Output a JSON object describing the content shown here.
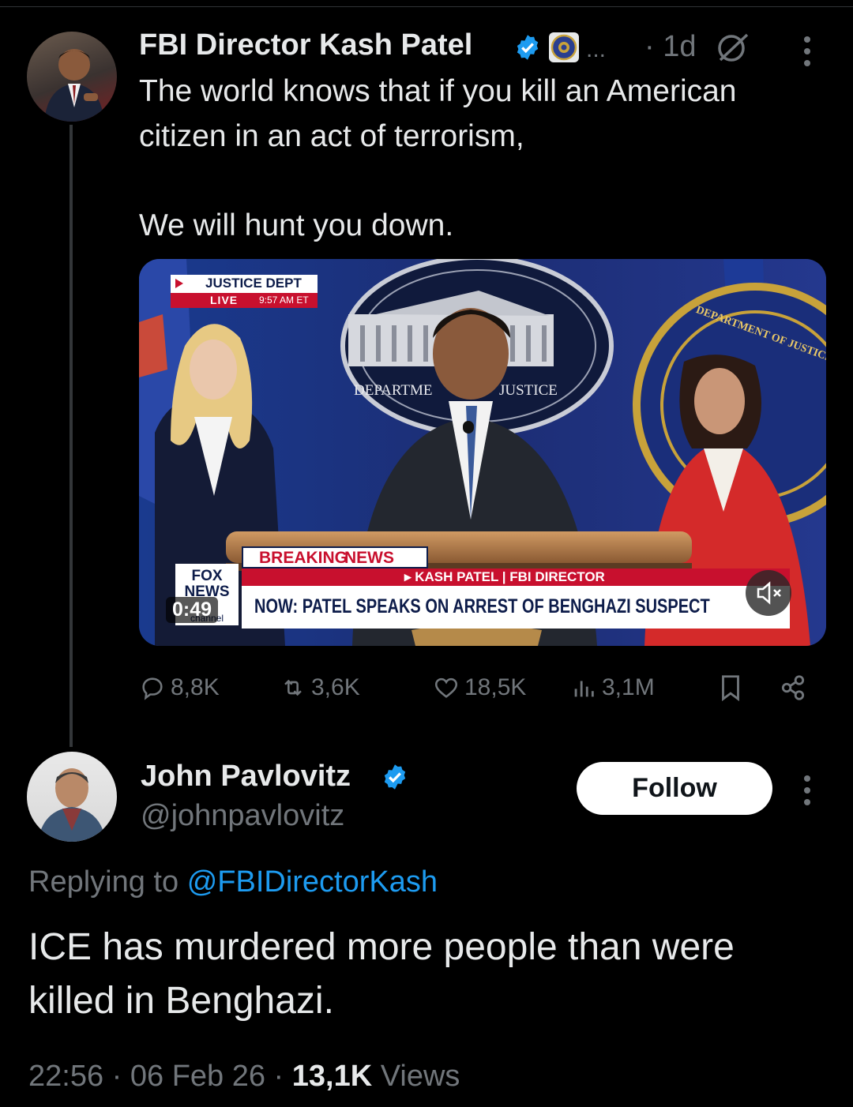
{
  "original_tweet": {
    "author_name": "FBI Director Kash Patel",
    "more_ellipsis": "...",
    "time": "· 1d",
    "text_line1": "The world knows that if you kill an American",
    "text_line2": "citizen in an act of terrorism,",
    "text_line3": "We will hunt you down.",
    "video": {
      "justice_dept_label": "JUSTICE DEPT",
      "live_label": "LIVE",
      "live_time": "9:57 AM ET",
      "seal_text_left": "DEPARTME",
      "seal_text_right": "JUSTICE",
      "fbi_seal_text": "DEPARTMENT OF JUSTICE",
      "breaking": "BREAKING",
      "news": "NEWS",
      "speaker_line": "▸ KASH PATEL | FBI DIRECTOR",
      "headline": "NOW: PATEL SPEAKS ON ARREST OF BENGHAZI SUSPECT",
      "network_logo": "FOX NEWS",
      "network_sub": "channel",
      "duration": "0:49",
      "mute_icon": "speaker-muted-icon"
    },
    "stats": {
      "replies": "8,8K",
      "reposts": "3,6K",
      "likes": "18,5K",
      "views": "3,1M"
    }
  },
  "reply": {
    "author_name": "John Pavlovitz",
    "handle": "@johnpavlovitz",
    "follow_label": "Follow",
    "replying_prefix": "Replying to",
    "replying_handle": "@FBIDirectorKash",
    "text_line1": "ICE has murdered more people than were",
    "text_line2": "killed in Benghazi.",
    "time": "22:56 · 06 Feb 26 ·",
    "views_count": "13,1K",
    "views_label": "Views"
  },
  "colors": {
    "background": "#000000",
    "text": "#e7e9ea",
    "muted": "#71767b",
    "link": "#1d9bf0",
    "verified": "#1d9bf0",
    "fox_red": "#c8102e"
  }
}
